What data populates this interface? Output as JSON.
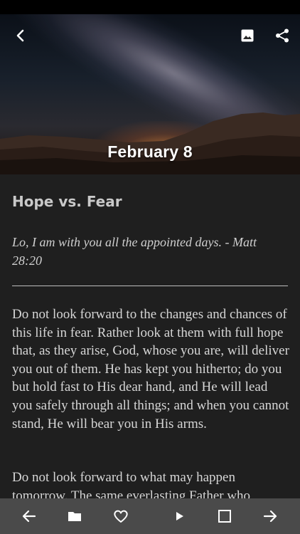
{
  "hero": {
    "date": "February 8",
    "icons": {
      "back": "arrow-left-icon",
      "image": "image-icon",
      "share": "share-icon"
    }
  },
  "reading": {
    "title": "Hope vs. Fear",
    "verse": "Lo, I am with you all the appointed days. - Matt 28:20",
    "paragraphs": [
      "Do not look forward to the changes and chances of this life in fear. Rather look at them with full hope that, as they arise, God, whose you are, will deliver you out of them. He has kept you hitherto; do you but hold fast to His dear hand, and He will lead you safely through all things; and when you cannot stand, He will bear you in His arms.",
      "Do not look forward to what may happen tomorrow. The same everlasting Father who"
    ]
  },
  "bottom_nav": {
    "icons": [
      "arrow-back-icon",
      "folder-icon",
      "heart-icon",
      "play-icon",
      "square-icon",
      "arrow-forward-icon"
    ]
  },
  "colors": {
    "background": "#1f1f1f",
    "bottom_bar": "#4a4a4a",
    "text": "#d6d6d6",
    "title": "#c9c9c9"
  }
}
